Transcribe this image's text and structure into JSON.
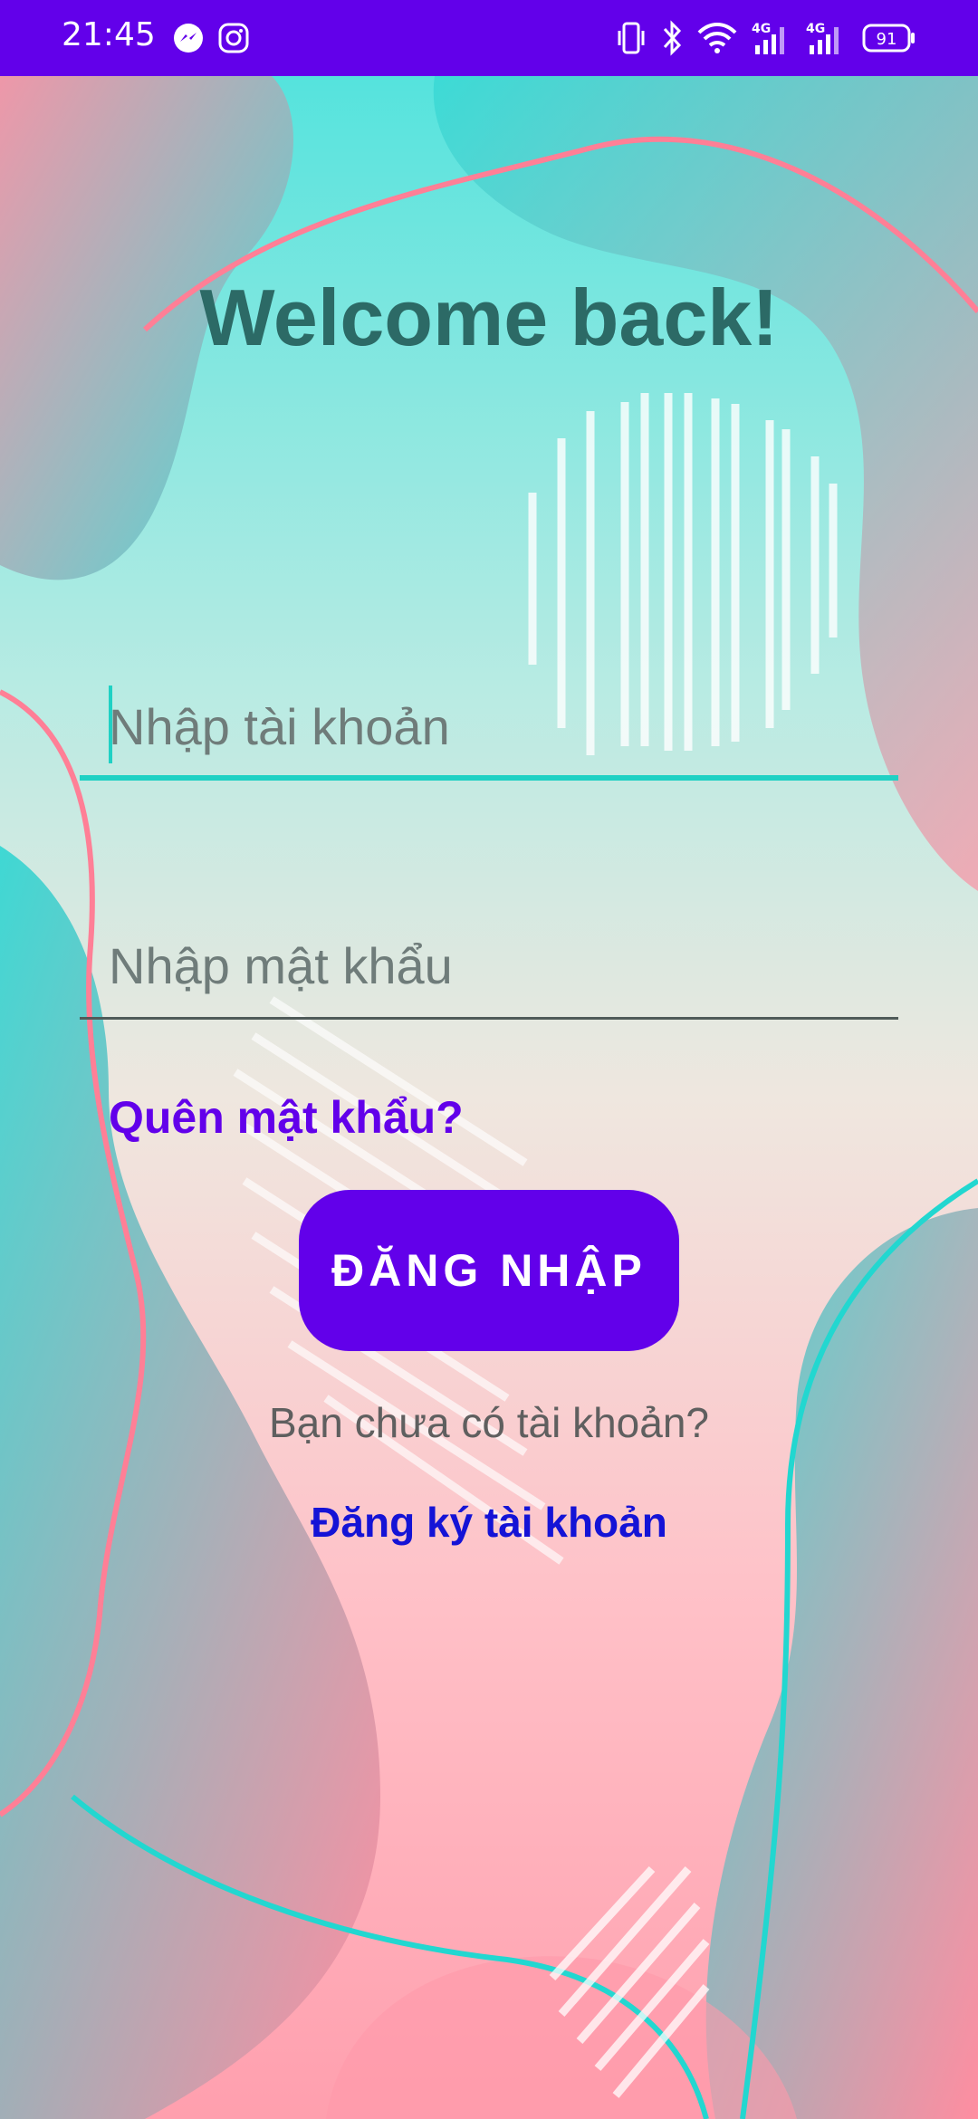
{
  "status_bar": {
    "time": "21:45",
    "icons": [
      "messenger-icon",
      "instagram-icon",
      "vibrate-icon",
      "bluetooth-icon",
      "wifi-icon",
      "signal-4g-icon",
      "signal-4g-icon",
      "battery-icon"
    ],
    "network_label_1": "4G",
    "network_label_2": "4G",
    "battery_level": "91"
  },
  "login": {
    "title": "Welcome back!",
    "username_placeholder": "Nhập tài khoản",
    "password_placeholder": "Nhập mật khẩu",
    "forgot_password": "Quên mật khẩu?",
    "login_button": "ĐĂNG NHẬP",
    "no_account_text": "Bạn chưa có tài khoản?",
    "register_link": "Đăng ký tài khoản"
  },
  "colors": {
    "accent": "#6200ea",
    "link_blue": "#1413d6",
    "teal": "#1fd1c4",
    "pink": "#ff8fa3",
    "title": "#2c6a66"
  }
}
